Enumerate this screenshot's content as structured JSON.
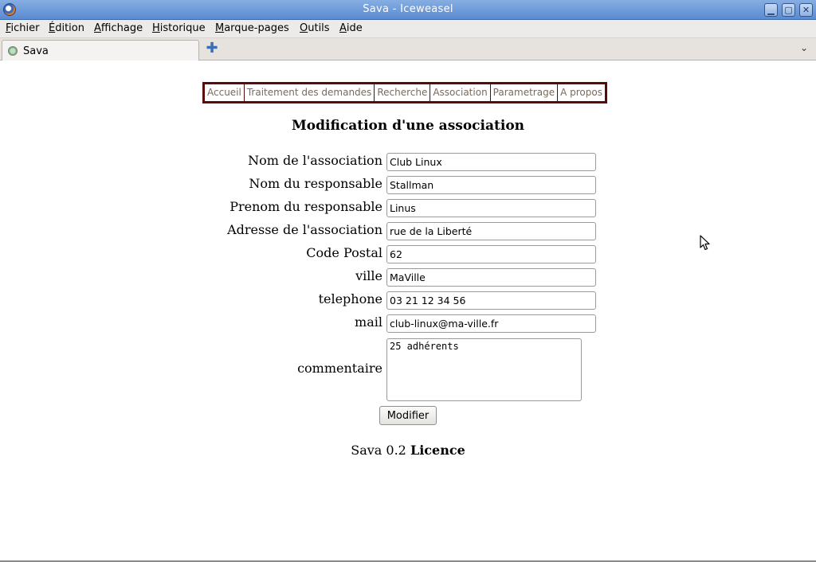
{
  "window": {
    "title": "Sava - Iceweasel",
    "icon": "iceweasel-icon",
    "buttons": {
      "minimize": "minimize-icon",
      "maximize": "maximize-icon",
      "close": "close-icon"
    }
  },
  "menu": {
    "items": [
      "Fichier",
      "Édition",
      "Affichage",
      "Historique",
      "Marque-pages",
      "Outils",
      "Aide"
    ]
  },
  "tabs": {
    "items": [
      {
        "label": "Sava",
        "icon": "page-favicon"
      }
    ],
    "new_tab_icon": "plus-icon",
    "list_icon": "chevron-down-icon"
  },
  "nav": {
    "links": [
      "Accueil",
      "Traitement des demandes",
      "Recherche",
      "Association",
      "Parametrage",
      "A propos"
    ]
  },
  "page": {
    "title": "Modification d'une association"
  },
  "form": {
    "fields": [
      {
        "label": "Nom de l'association",
        "value": "Club Linux"
      },
      {
        "label": "Nom du responsable",
        "value": "Stallman"
      },
      {
        "label": "Prenom du responsable",
        "value": "Linus"
      },
      {
        "label": "Adresse de l'association",
        "value": "rue de la Liberté"
      },
      {
        "label": "Code Postal",
        "value": "62"
      },
      {
        "label": "ville",
        "value": "MaVille"
      },
      {
        "label": "telephone",
        "value": "03 21 12 34 56"
      },
      {
        "label": "mail",
        "value": "club-linux@ma-ville.fr"
      }
    ],
    "comment": {
      "label": "commentaire",
      "value": "25 adhérents"
    },
    "submit_label": "Modifier"
  },
  "footer": {
    "version": "Sava 0.2",
    "licence": "Licence"
  }
}
